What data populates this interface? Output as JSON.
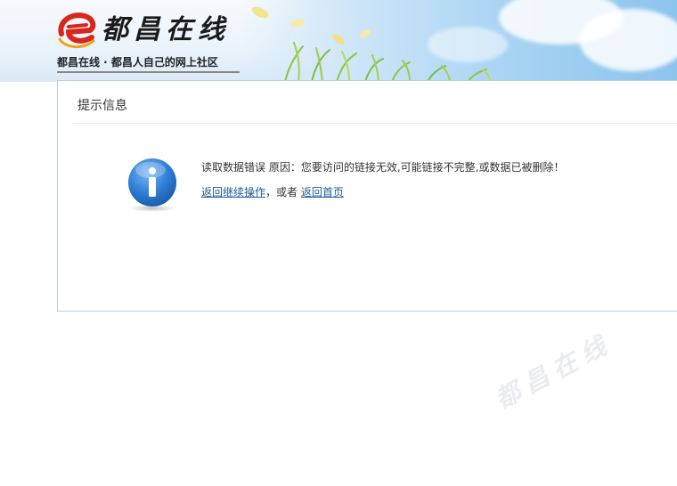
{
  "header": {
    "logo_text": "都昌在线",
    "slogan": "都昌在线 · 都昌人自己的网上社区"
  },
  "panel": {
    "title": "提示信息",
    "message": "读取数据错误 原因：您要访问的链接无效,可能链接不完整,或数据已被删除！",
    "continue_link": "返回继续操作",
    "separator": "，或者",
    "home_link": "返回首页"
  },
  "watermark": {
    "text": "都昌在线"
  },
  "icons": {
    "logo": "logo-e-icon",
    "info": "info-icon"
  },
  "colors": {
    "link": "#1c5a96",
    "panel_border": "#b9cfe0",
    "info_icon": "#2f7fd6",
    "logo_red": "#d8261c"
  }
}
